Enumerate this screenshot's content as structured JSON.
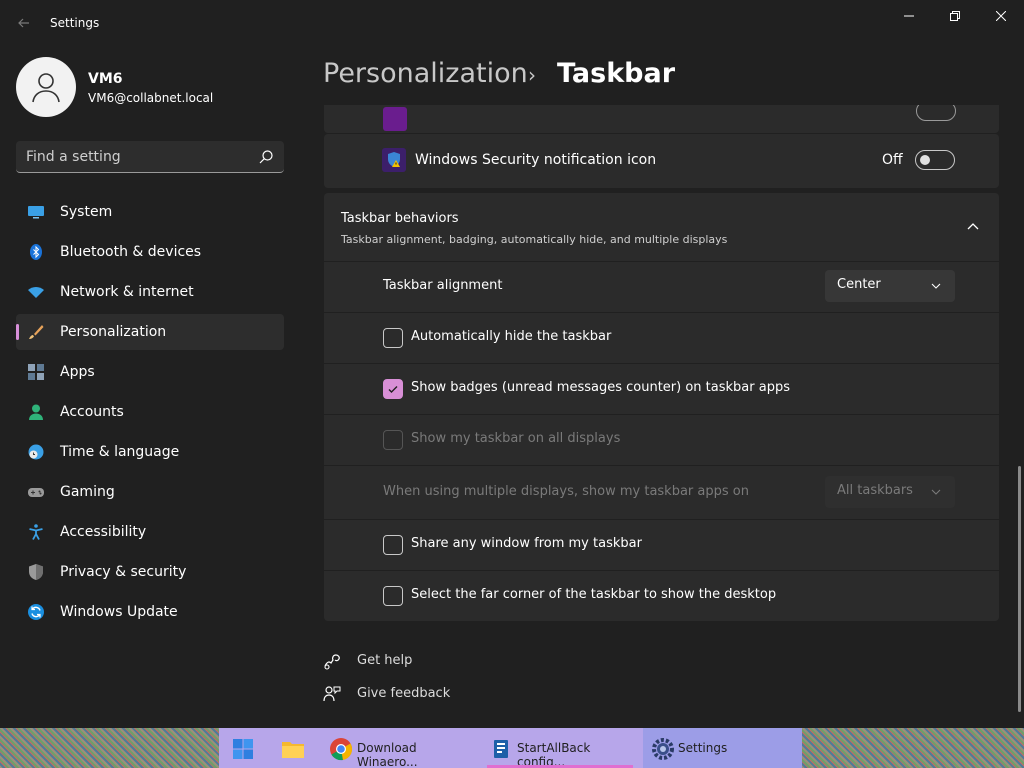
{
  "window": {
    "title": "Settings"
  },
  "user": {
    "name": "VM6",
    "email": "VM6@collabnet.local"
  },
  "search": {
    "placeholder": "Find a setting"
  },
  "nav": {
    "items": [
      {
        "label": "System"
      },
      {
        "label": "Bluetooth & devices"
      },
      {
        "label": "Network & internet"
      },
      {
        "label": "Personalization"
      },
      {
        "label": "Apps"
      },
      {
        "label": "Accounts"
      },
      {
        "label": "Time & language"
      },
      {
        "label": "Gaming"
      },
      {
        "label": "Accessibility"
      },
      {
        "label": "Privacy & security"
      },
      {
        "label": "Windows Update"
      }
    ],
    "active_index": 3
  },
  "breadcrumb": {
    "parent": "Personalization",
    "separator": "›",
    "current": "Taskbar"
  },
  "security_row": {
    "label": "Windows Security notification icon",
    "toggle_text": "Off"
  },
  "behaviors": {
    "title": "Taskbar behaviors",
    "subtitle": "Taskbar alignment, badging, automatically hide, and multiple displays",
    "alignment_label": "Taskbar alignment",
    "alignment_value": "Center",
    "auto_hide_label": "Automatically hide the taskbar",
    "badges_label": "Show badges (unread messages counter) on taskbar apps",
    "all_displays_label": "Show my taskbar on all displays",
    "multi_display_label": "When using multiple displays, show my taskbar apps on",
    "multi_display_value": "All taskbars",
    "share_window_label": "Share any window from my taskbar",
    "far_corner_label": "Select the far corner of the taskbar to show the desktop"
  },
  "links": {
    "help": "Get help",
    "feedback": "Give feedback"
  },
  "taskbar": {
    "chrome_label": "Download Winaero...",
    "startallback_label": "StartAllBack config...",
    "settings_label": "Settings"
  }
}
